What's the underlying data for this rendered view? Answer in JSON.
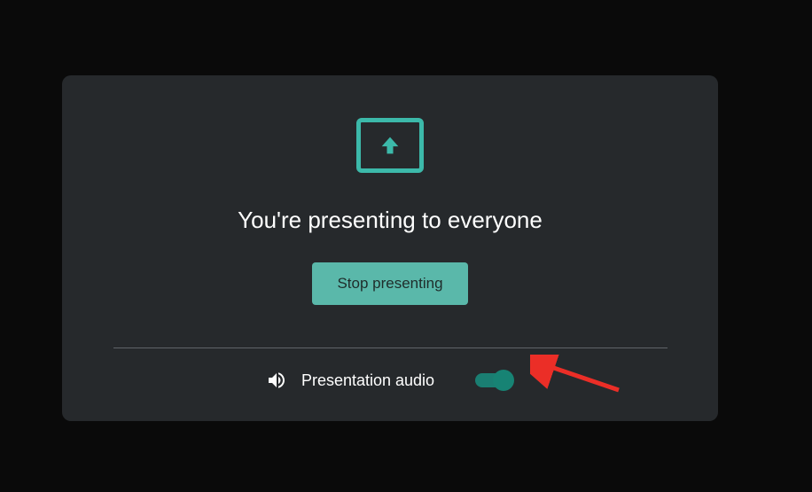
{
  "card": {
    "heading": "You're presenting to everyone",
    "stop_button_label": "Stop presenting",
    "audio_label": "Presentation audio",
    "audio_toggle_on": true
  },
  "colors": {
    "accent": "#3cb9aa",
    "button_bg": "#5ab8aa",
    "card_bg": "#26292c",
    "toggle_track": "#1a7e72",
    "toggle_thumb": "#178374",
    "annotation": "#eb2e27"
  },
  "icons": {
    "present": "present-to-all-icon",
    "volume": "volume-icon"
  }
}
